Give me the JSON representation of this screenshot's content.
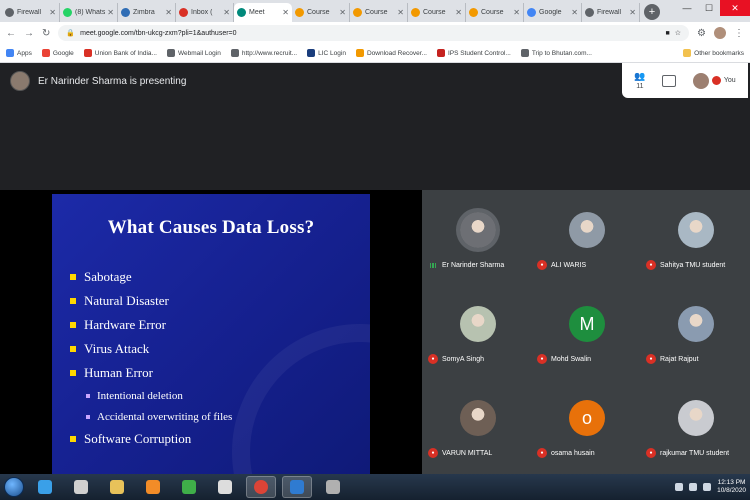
{
  "tabs": [
    {
      "title": "Firewall",
      "color": "#5f6368",
      "active": false
    },
    {
      "title": "(8) WhatsApp",
      "color": "#25d366",
      "active": false
    },
    {
      "title": "Zimbra",
      "color": "#2f6db5",
      "active": false
    },
    {
      "title": "Inbox (",
      "color": "#d93025",
      "active": false
    },
    {
      "title": "Meet",
      "color": "#00897b",
      "active": true
    },
    {
      "title": "Course",
      "color": "#f29900",
      "active": false
    },
    {
      "title": "Course",
      "color": "#f29900",
      "active": false
    },
    {
      "title": "Course",
      "color": "#f29900",
      "active": false
    },
    {
      "title": "Course",
      "color": "#f29900",
      "active": false
    },
    {
      "title": "Google",
      "color": "#4285f4",
      "active": false
    },
    {
      "title": "Firewall",
      "color": "#5f6368",
      "active": false
    }
  ],
  "toolbar": {
    "url": "meet.google.com/tbn-ukcg-zxm?pli=1&authuser=0"
  },
  "bookmarks": [
    {
      "label": "Apps",
      "color": "#4285f4"
    },
    {
      "label": "Google",
      "color": "#ea4335"
    },
    {
      "label": "Union Bank of India...",
      "color": "#d93025"
    },
    {
      "label": "Webmail Login",
      "color": "#5f6368"
    },
    {
      "label": "http://www.recruit...",
      "color": "#5f6368"
    },
    {
      "label": "LIC Login",
      "color": "#1a3d7c"
    },
    {
      "label": "Download Recover...",
      "color": "#f29900"
    },
    {
      "label": "IPS Student Control...",
      "color": "#c5221f"
    },
    {
      "label": "Trip to Bhutan.com...",
      "color": "#5f6368"
    }
  ],
  "other_bookmarks": "Other bookmarks",
  "meet": {
    "presenter_text": "Er Narinder Sharma is presenting",
    "people_count": "11",
    "you_label": "You"
  },
  "slide": {
    "title": "What Causes Data Loss?",
    "items": [
      {
        "text": "Sabotage",
        "level": 1
      },
      {
        "text": "Natural Disaster",
        "level": 1
      },
      {
        "text": "Hardware Error",
        "level": 1
      },
      {
        "text": "Virus Attack",
        "level": 1
      },
      {
        "text": "Human Error",
        "level": 1
      },
      {
        "text": "Intentional deletion",
        "level": 2
      },
      {
        "text": "Accidental overwriting of files",
        "level": 2
      },
      {
        "text": "Software Corruption",
        "level": 1
      }
    ]
  },
  "participants": [
    {
      "name": "Er Narinder Sharma",
      "muted": false,
      "avatar": "photo",
      "color": "#6d6f74"
    },
    {
      "name": "ALI WARIS",
      "muted": true,
      "avatar": "photo",
      "color": "#8f9aa6"
    },
    {
      "name": "Sahitya TMU student",
      "muted": true,
      "avatar": "photo",
      "color": "#a9b8c4"
    },
    {
      "name": "SomyA Singh",
      "muted": true,
      "avatar": "photo",
      "color": "#b7c2b0"
    },
    {
      "name": "Mohd Swalin",
      "muted": true,
      "avatar": "M",
      "color": "#1e8e3e"
    },
    {
      "name": "Rajat Rajput",
      "muted": true,
      "avatar": "photo",
      "color": "#8a9bb0"
    },
    {
      "name": "VARUN MITTAL",
      "muted": true,
      "avatar": "photo",
      "color": "#6e5f55"
    },
    {
      "name": "osama husain",
      "muted": true,
      "avatar": "o",
      "color": "#e8710a"
    },
    {
      "name": "rajkumar TMU student",
      "muted": true,
      "avatar": "photo",
      "color": "#c9cbd0"
    }
  ],
  "taskbar": {
    "apps": [
      {
        "name": "ie-icon",
        "color": "#3aa0e8"
      },
      {
        "name": "app-icon",
        "color": "#d0d0d0"
      },
      {
        "name": "folder-icon",
        "color": "#e8c25a"
      },
      {
        "name": "media-icon",
        "color": "#f28c28"
      },
      {
        "name": "torrent-icon",
        "color": "#3fae49"
      },
      {
        "name": "app2-icon",
        "color": "#dddddd"
      },
      {
        "name": "chrome-icon",
        "color": "#db4437"
      },
      {
        "name": "app3-icon",
        "color": "#2f7bd1"
      },
      {
        "name": "app4-icon",
        "color": "#b0b0b0"
      }
    ],
    "time": "12:13 PM",
    "date": "10/8/2020"
  }
}
